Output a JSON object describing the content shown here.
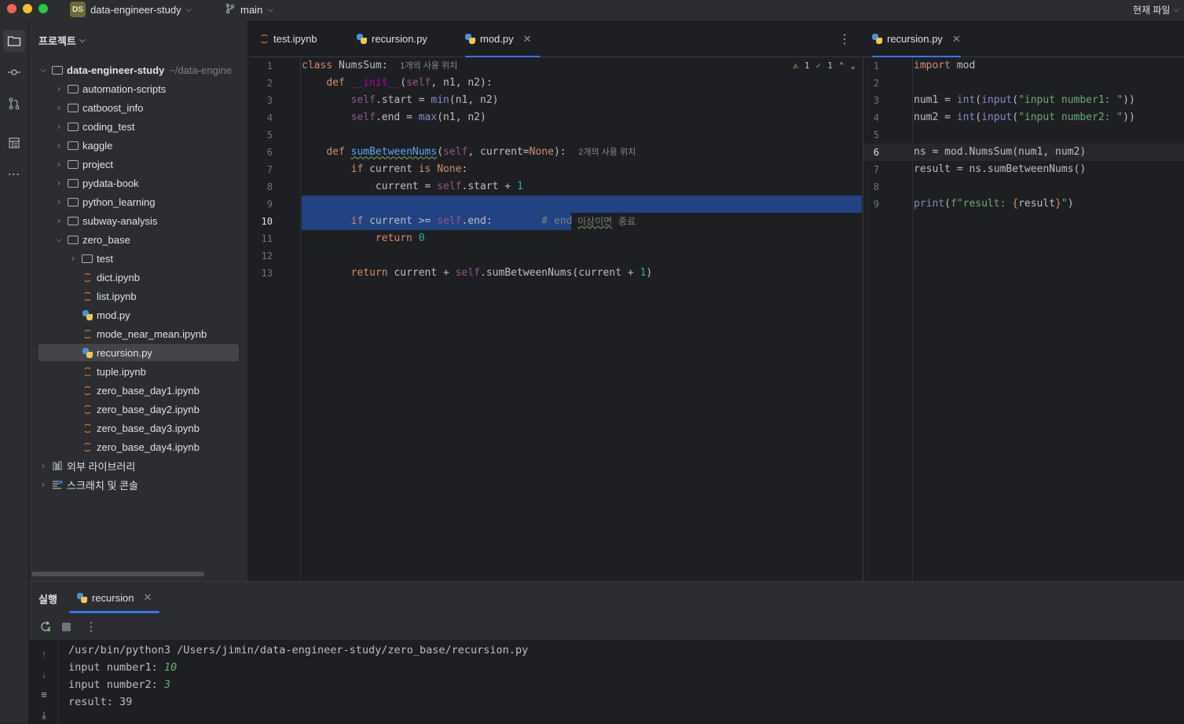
{
  "titlebar": {
    "project_badge": "DS",
    "project_name": "data-engineer-study",
    "branch": "main",
    "current_file_label": "현재 파일"
  },
  "project_panel": {
    "header": "프로젝트",
    "root_name": "data-engineer-study",
    "root_path": "~/data-engine",
    "items": [
      {
        "label": "automation-scripts",
        "type": "folder"
      },
      {
        "label": "catboost_info",
        "type": "folder"
      },
      {
        "label": "coding_test",
        "type": "folder"
      },
      {
        "label": "kaggle",
        "type": "folder"
      },
      {
        "label": "project",
        "type": "folder"
      },
      {
        "label": "pydata-book",
        "type": "folder"
      },
      {
        "label": "python_learning",
        "type": "folder"
      },
      {
        "label": "subway-analysis",
        "type": "folder"
      },
      {
        "label": "zero_base",
        "type": "folder-open"
      },
      {
        "label": "test",
        "type": "folder"
      },
      {
        "label": "dict.ipynb",
        "type": "notebook"
      },
      {
        "label": "list.ipynb",
        "type": "notebook"
      },
      {
        "label": "mod.py",
        "type": "python"
      },
      {
        "label": "mode_near_mean.ipynb",
        "type": "notebook"
      },
      {
        "label": "recursion.py",
        "type": "python"
      },
      {
        "label": "tuple.ipynb",
        "type": "notebook"
      },
      {
        "label": "zero_base_day1.ipynb",
        "type": "notebook"
      },
      {
        "label": "zero_base_day2.ipynb",
        "type": "notebook"
      },
      {
        "label": "zero_base_day3.ipynb",
        "type": "notebook"
      },
      {
        "label": "zero_base_day4.ipynb",
        "type": "notebook"
      }
    ],
    "external_libraries": "외부 라이브러리",
    "scratches": "스크래치 및 콘솔"
  },
  "left_tabs": [
    "test.ipynb",
    "recursion.py",
    "mod.py"
  ],
  "right_tabs": [
    "recursion.py"
  ],
  "left_editor": {
    "inspection": {
      "warnings": "1",
      "ok": "1"
    },
    "usage_hint_class": "1개의 사용 위치",
    "usage_hint_method": "2개의 사용 위치",
    "comment_text": "# end",
    "comment_korean": "이상이면",
    "comment_korean_2": "종료"
  },
  "right_editor": {
    "line_count": 9
  },
  "run_panel": {
    "title": "실행",
    "tab_label": "recursion",
    "console": {
      "command": "/usr/bin/python3 /Users/jimin/data-engineer-study/zero_base/recursion.py",
      "prompt1": "input number1: ",
      "input1": "10",
      "prompt2": "input number2: ",
      "input2": "3",
      "result": "result: 39"
    }
  },
  "colors": {
    "accent": "#3574f0",
    "selection": "#214283",
    "background": "#1e1f22",
    "panel": "#2b2d30"
  }
}
